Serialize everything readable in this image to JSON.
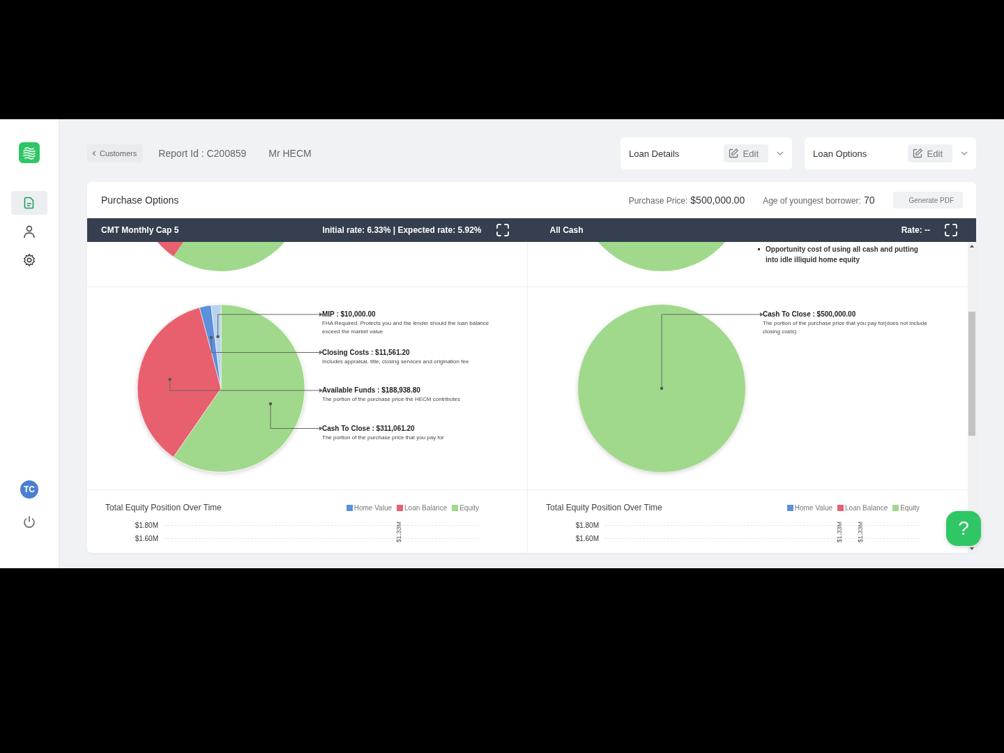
{
  "sidebar": {
    "nav_items": [
      {
        "selected": true
      },
      {
        "selected": false
      },
      {
        "selected": false
      }
    ],
    "avatar": "TC"
  },
  "header": {
    "back_button": "Customers",
    "report_id": "Report Id : C200859",
    "customer": "Mr HECM",
    "panels": [
      {
        "title": "Loan Details",
        "edit": "Edit"
      },
      {
        "title": "Loan Options",
        "edit": "Edit"
      }
    ]
  },
  "card": {
    "title": "Purchase Options",
    "purchase_price_label": "Purchase Price:",
    "purchase_price": "$500,000.00",
    "age_label": "Age of youngest borrower:",
    "age": "70",
    "generate_button": "Generate PDF",
    "options": [
      {
        "name": "CMT Monthly Cap 5",
        "rates": "Initial rate: 6.33% | Expected rate: 5.92%",
        "chart_data": {
          "type": "pie",
          "values": [
            59.64,
            36.23,
            2.22,
            1.91
          ],
          "colors": [
            "#a0d98b",
            "#e8606e",
            "#5b8fdc",
            "#b9d3ef"
          ]
        },
        "callouts": [
          {
            "heading": "MIP : $10,000.00",
            "text": "FHA Required. Protects you and the lender should the loan balance exceed the market value"
          },
          {
            "heading": "Closing Costs : $11,561.20",
            "text": "Includes appraisal, title, closing services and origination fee"
          },
          {
            "heading": "Available Funds : $188,938.80",
            "text": "The portion of the purchase price the HECM contributes"
          },
          {
            "heading": "Cash To Close : $311,061.20",
            "text": "The portion of the purchase price that you pay for"
          }
        ],
        "equity_chart": {
          "title": "Total Equity Position Over Time",
          "legend": [
            {
              "name": "Home Value",
              "color": "#5b8fdc"
            },
            {
              "name": "Loan Balance",
              "color": "#e8606e"
            },
            {
              "name": "Equity",
              "color": "#a0d98b"
            }
          ],
          "y_ticks": [
            "$1.80M",
            "$1.60M"
          ],
          "value_labels": [
            "$1.33M"
          ]
        }
      },
      {
        "name": "All Cash",
        "rates": "Rate: --",
        "notes": [
          "Opportunity cost of using all cash and putting into idle illiquid home equity"
        ],
        "chart_data": {
          "type": "pie",
          "values": [
            100
          ],
          "colors": [
            "#a0d98b"
          ]
        },
        "callouts": [
          {
            "heading": "Cash To Close : $500,000.00",
            "text": "The portion of the purchase price that you pay for(does not include closing costs)"
          }
        ],
        "equity_chart": {
          "title": "Total Equity Position Over Time",
          "legend": [
            {
              "name": "Home Value",
              "color": "#5b8fdc"
            },
            {
              "name": "Loan Balance",
              "color": "#e8606e"
            },
            {
              "name": "Equity",
              "color": "#a0d98b"
            }
          ],
          "y_ticks": [
            "$1.80M",
            "$1.60M"
          ],
          "value_labels": [
            "$1.33M",
            "$1.33M"
          ]
        }
      }
    ]
  },
  "help_button": "?"
}
